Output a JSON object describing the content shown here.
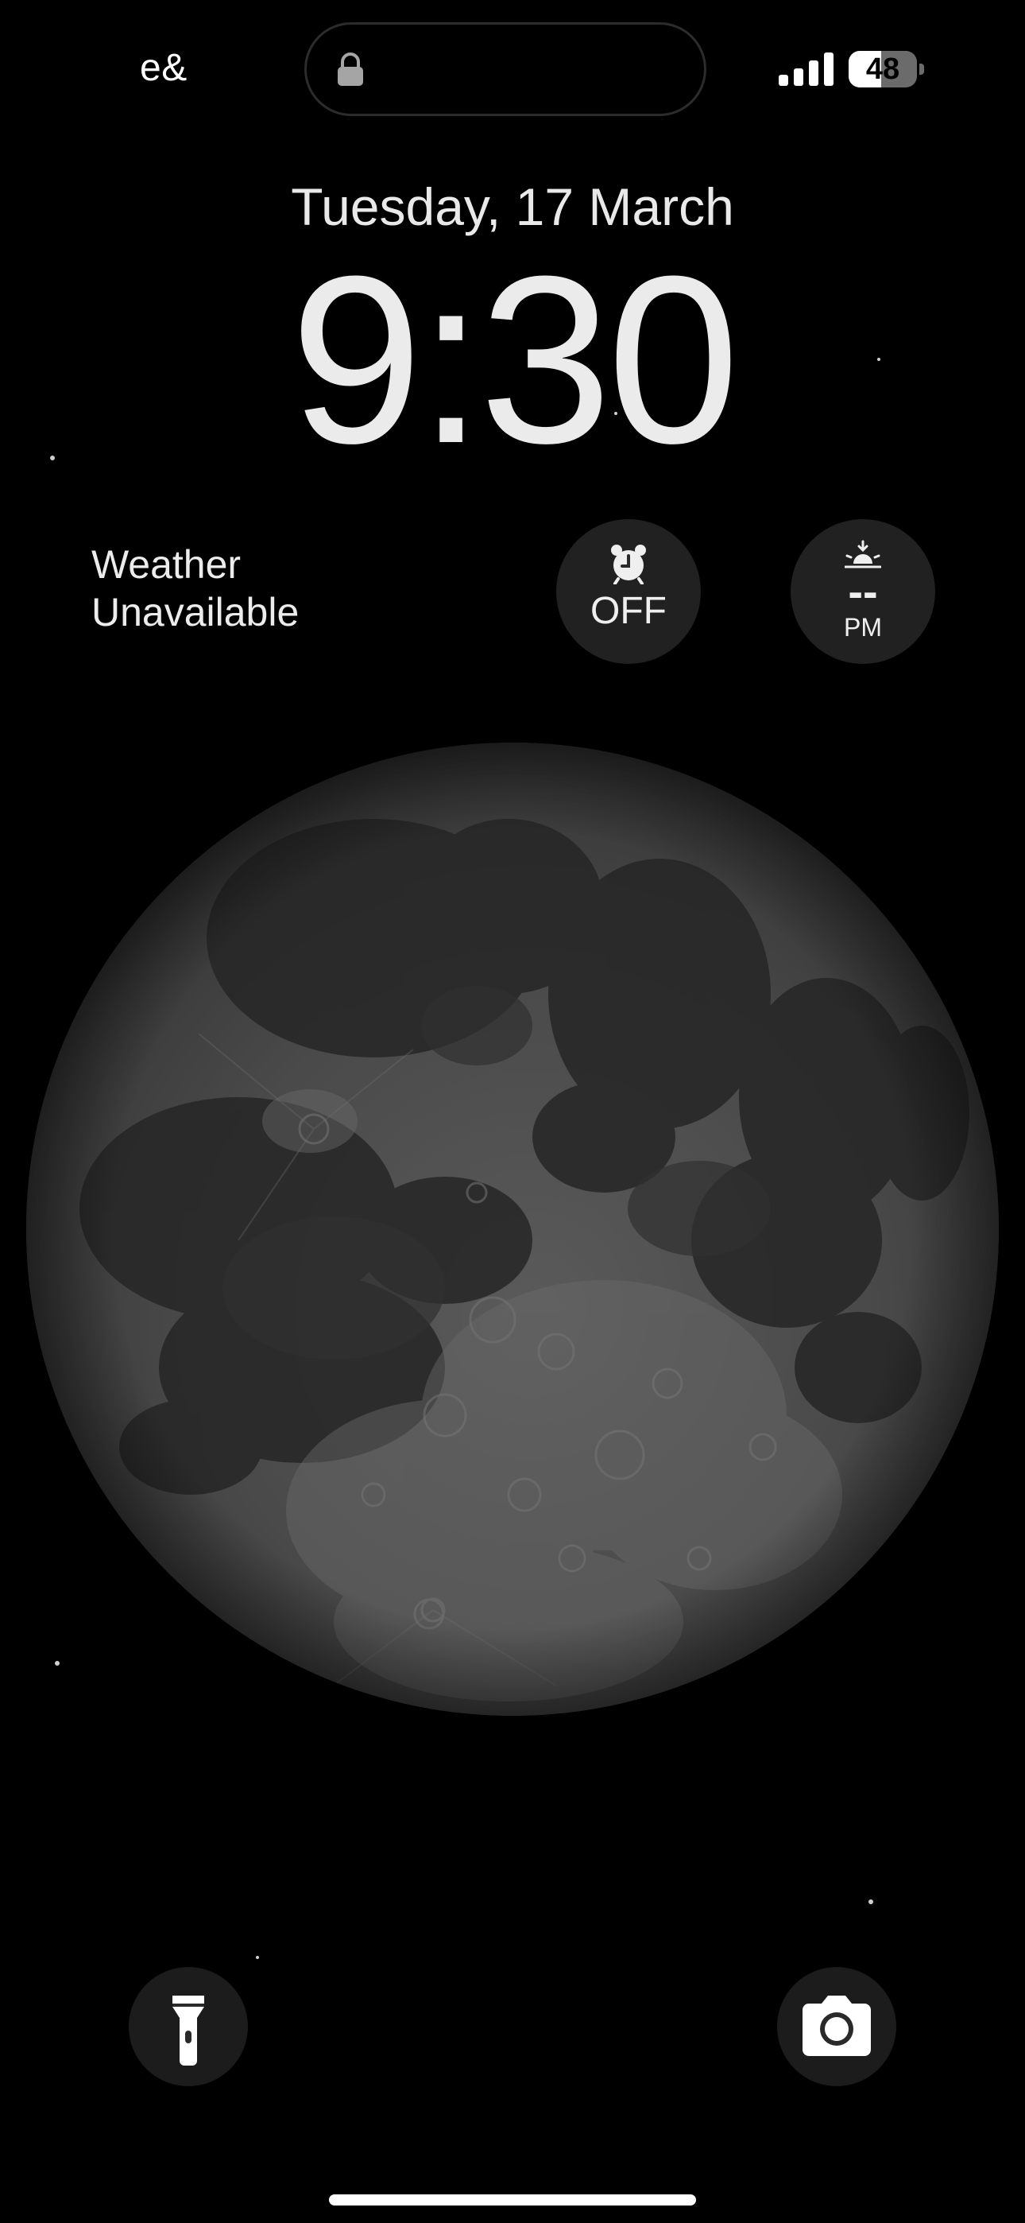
{
  "status_bar": {
    "carrier": "e&",
    "battery_level": "48",
    "battery_fraction": 0.48,
    "island_icon": "lock-icon",
    "signal_icon": "cellular-signal-icon"
  },
  "lock_screen": {
    "date": "Tuesday, 17 March",
    "time": "9:30"
  },
  "widgets": {
    "weather": {
      "line1": "Weather",
      "line2": "Unavailable"
    },
    "alarm": {
      "icon": "alarm-clock-icon",
      "label": "OFF"
    },
    "sunrise": {
      "icon": "sunrise-icon",
      "value": "--",
      "period": "PM"
    }
  },
  "wallpaper": {
    "subject": "moon"
  },
  "quick_actions": {
    "flashlight_icon": "flashlight-icon",
    "camera_icon": "camera-icon"
  },
  "colors": {
    "background": "#000000",
    "text": "#ebebeb",
    "widget_bg": "#222222"
  }
}
